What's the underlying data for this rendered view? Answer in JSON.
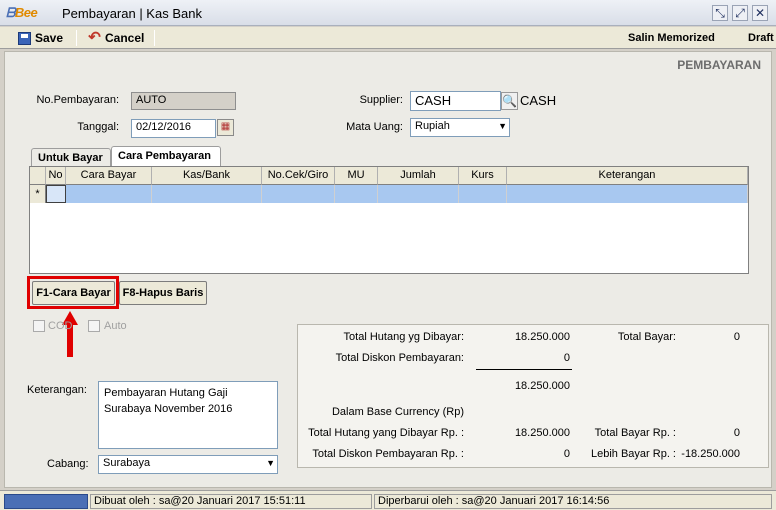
{
  "window": {
    "app": "Bee",
    "title": "Pembayaran | Kas Bank"
  },
  "toolbar": {
    "save": "Save",
    "cancel": "Cancel",
    "memorized": "Salin Memorized",
    "draft": "Draft"
  },
  "heading": "PEMBAYARAN",
  "fields": {
    "no_label": "No.Pembayaran:",
    "no_value": "AUTO",
    "tanggal_label": "Tanggal:",
    "tanggal_value": "02/12/2016",
    "supplier_label": "Supplier:",
    "supplier_code": "CASH",
    "supplier_name": "CASH",
    "mata_uang_label": "Mata Uang:",
    "mata_uang_value": "Rupiah"
  },
  "tabs": [
    "Untuk Bayar",
    "Cara Pembayaran"
  ],
  "grid": {
    "columns": [
      "No",
      "Cara Bayar",
      "Kas/Bank",
      "No.Cek/Giro",
      "MU",
      "Jumlah",
      "Kurs",
      "Keterangan"
    ],
    "row_marker": "*"
  },
  "buttons": {
    "f1": "F1-Cara Bayar",
    "f8": "F8-Hapus Baris"
  },
  "options": {
    "cod": "COD",
    "auto": "Auto"
  },
  "keterangan": {
    "label": "Keterangan:",
    "lines": [
      "Pembayaran Hutang Gaji",
      "Surabaya November 2016"
    ]
  },
  "cabang": {
    "label": "Cabang:",
    "value": "Surabaya"
  },
  "summary": {
    "total_hutang_label": "Total Hutang yg Dibayar:",
    "total_hutang": "18.250.000",
    "total_diskon_label": "Total Diskon Pembayaran:",
    "total_diskon": "0",
    "subtotal": "18.250.000",
    "total_bayar_label": "Total Bayar:",
    "total_bayar": "0",
    "base_label": "Dalam Base Currency (Rp)",
    "hutang_rp_label": "Total Hutang yang Dibayar Rp. :",
    "hutang_rp": "18.250.000",
    "bayar_rp_label": "Total Bayar Rp. :",
    "bayar_rp": "0",
    "diskon_rp_label": "Total Diskon Pembayaran Rp. :",
    "diskon_rp": "0",
    "lebih_label": "Lebih Bayar Rp. :",
    "lebih": "-18.250.000"
  },
  "status": {
    "created": "Dibuat oleh : sa@20 Januari 2017  15:51:11",
    "updated": "Diperbarui oleh : sa@20 Januari 2017  16:14:56"
  },
  "colors": {
    "highlight": "#e00000",
    "grid_row": "#a8c8f0"
  }
}
